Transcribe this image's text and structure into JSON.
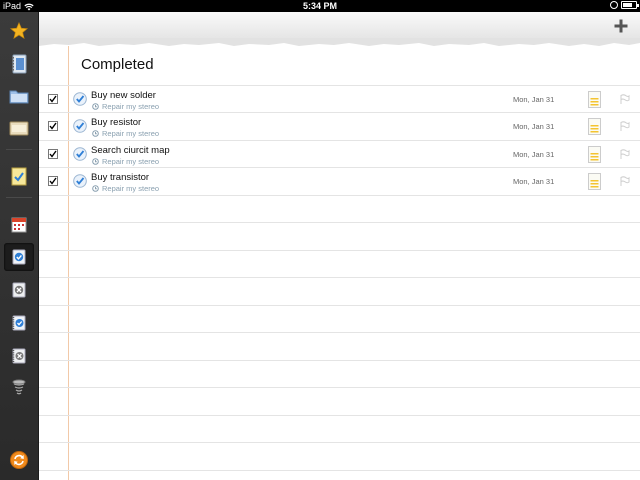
{
  "status_bar": {
    "device": "iPad",
    "time": "5:34 PM"
  },
  "list": {
    "title": "Completed",
    "items": [
      {
        "title": "Buy new solder",
        "project": "Repair my stereo",
        "date": "Mon, Jan 31",
        "checked": true
      },
      {
        "title": "Buy resistor",
        "project": "Repair my stereo",
        "date": "Mon, Jan 31",
        "checked": true
      },
      {
        "title": "Search ciurcit map",
        "project": "Repair my stereo",
        "date": "Mon, Jan 31",
        "checked": true
      },
      {
        "title": "Buy transistor",
        "project": "Repair my stereo",
        "date": "Mon, Jan 31",
        "checked": true
      }
    ]
  },
  "sidebar": {
    "items": [
      {
        "icon": "star-icon"
      },
      {
        "icon": "notebook-icon"
      },
      {
        "icon": "folder-icon"
      },
      {
        "icon": "inbox-tray-icon"
      },
      {
        "icon": "task-note-icon"
      },
      {
        "icon": "calendar-icon"
      },
      {
        "icon": "completed-check-icon",
        "selected": true
      },
      {
        "icon": "cancelled-x-icon"
      },
      {
        "icon": "notebook-check-icon"
      },
      {
        "icon": "notebook-x-icon"
      },
      {
        "icon": "trash-spring-icon"
      },
      {
        "icon": "sync-icon"
      }
    ]
  },
  "colors": {
    "sidebar_bg": "#333333",
    "check_blue": "#2f7fd6",
    "sync_orange": "#f08a1c",
    "note_yellow": "#f4c430",
    "margin_line": "#f2c9a8"
  }
}
